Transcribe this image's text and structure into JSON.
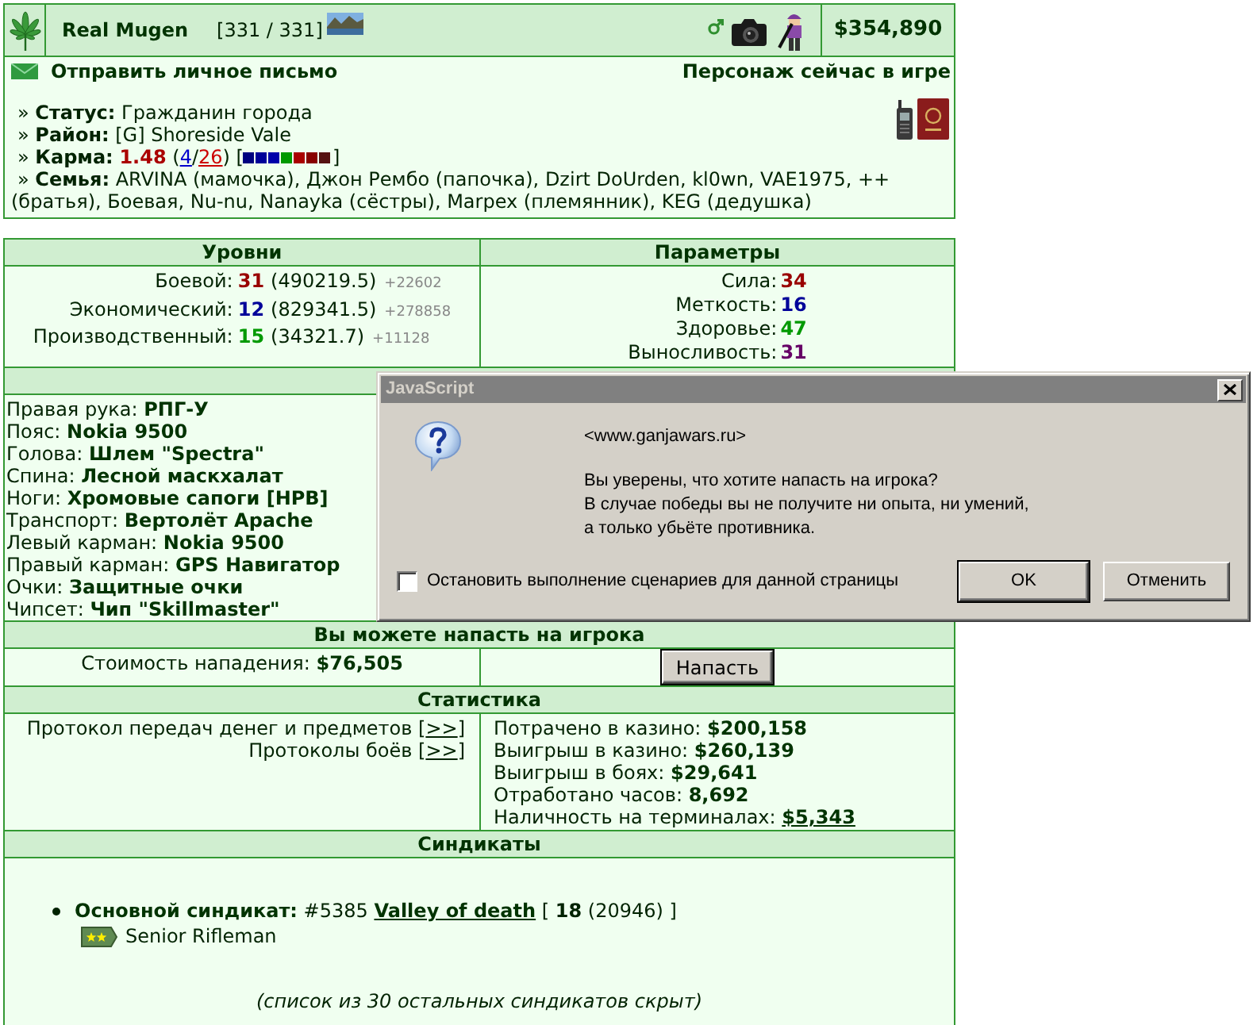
{
  "profile": {
    "name": "Real Mugen",
    "hp": "[331 / 331]",
    "money": "$354,890"
  },
  "contact": {
    "message_link": "Отправить личное письмо",
    "online_status": "Персонаж сейчас в игре"
  },
  "info": [
    {
      "kind": "text",
      "text": "» **Статус:** Гражданин города"
    },
    {
      "kind": "text",
      "text": "» **Район:** [G] Shoreside Vale"
    },
    {
      "kind": "karma",
      "label": "» **Карма:**",
      "value": "1.48",
      "votes": [
        {
          "kind": "plain",
          "text": "("
        },
        {
          "kind": "positive",
          "text": "4"
        },
        {
          "kind": "plain",
          "text": "/"
        },
        {
          "kind": "negative",
          "text": "26"
        },
        {
          "kind": "plain",
          "text": ")"
        }
      ],
      "bracket_open": "[",
      "squares": [
        {
          "color": "#000080"
        },
        {
          "color": "#000099"
        },
        {
          "color": "#0000aa"
        },
        {
          "color": "#009900"
        },
        {
          "color": "#aa0000"
        },
        {
          "color": "#880000"
        },
        {
          "color": "#551111"
        }
      ],
      "bracket_close": "]"
    },
    {
      "kind": "text",
      "text": "» **Семья:** ARVINA (мамочка), Джон Рембо (папочка), Dzirt DoUrden, kl0wn, VAE1975, ++ (братья), Боевая, Nu-nu, Nanayka (сёстры), Marpex (племянник), KEG (дедушка)"
    }
  ],
  "levels": {
    "title": "Уровни",
    "rows": [
      {
        "label": "Боевой:",
        "value": "31",
        "color": "#990000",
        "exp": "(490219.5)",
        "gain": "+22602"
      },
      {
        "label": "Экономический:",
        "value": "12",
        "color": "#000099",
        "exp": "(829341.5)",
        "gain": "+278858"
      },
      {
        "label": "Производственный:",
        "value": "15",
        "color": "#009900",
        "exp": "(34321.7)",
        "gain": "+11128"
      }
    ]
  },
  "parameters": {
    "title": "Параметры",
    "rows": [
      {
        "label": "Сила:",
        "value": "34",
        "color": "#990000"
      },
      {
        "label": "Меткость:",
        "value": "16",
        "color": "#000099"
      },
      {
        "label": "Здоровье:",
        "value": "47",
        "color": "#009900"
      },
      {
        "label": "Выносливость:",
        "value": "31",
        "color": "#660066"
      }
    ]
  },
  "equipment": [
    {
      "slot": "Правая рука:",
      "item": "РПГ-У"
    },
    {
      "slot": "Пояс:",
      "item": "Nokia 9500"
    },
    {
      "slot": "Голова:",
      "item": "Шлем \"Spectra\""
    },
    {
      "slot": "Спина:",
      "item": "Лесной маскхалат"
    },
    {
      "slot": "Ноги:",
      "item": "Хромовые сапоги [HPB]"
    },
    {
      "slot": "Транспорт:",
      "item": "Вертолёт Apache"
    },
    {
      "slot": "Левый карман:",
      "item": "Nokia 9500"
    },
    {
      "slot": "Правый карман:",
      "item": "GPS Навигатор"
    },
    {
      "slot": "Очки:",
      "item": "Защитные очки"
    },
    {
      "slot": "Чипсет:",
      "item": "Чип \"Skillmaster\""
    }
  ],
  "attack": {
    "title": "Вы можете напасть на игрока",
    "cost_label": "Стоимость нападения:",
    "cost": "$76,505",
    "button": "Напасть"
  },
  "statistics": {
    "title": "Статистика",
    "logs": [
      {
        "before": "Протокол передач денег и предметов [",
        "link": ">>",
        "after": "]"
      },
      {
        "before": "Протоколы боёв [",
        "link": ">>",
        "after": "]"
      }
    ],
    "rows": [
      {
        "kind": "plain",
        "label": "Потрачено в казино:",
        "value": "$200,158"
      },
      {
        "kind": "plain",
        "label": "Выигрыш в казино:",
        "value": "$260,139"
      },
      {
        "kind": "plain",
        "label": "Выигрыш в боях:",
        "value": "$29,641"
      },
      {
        "kind": "plain",
        "label": "Отработано часов:",
        "value": "8,692"
      },
      {
        "kind": "link",
        "label": "Наличность на терминалах:",
        "value": "$5,343"
      }
    ]
  },
  "syndicates": {
    "title": "Синдикаты",
    "main": {
      "label": "Основной синдикат:",
      "number": "#5385",
      "name": "Valley of death",
      "rank_text": "[ **18** (20946) ]",
      "role": "Senior Rifleman"
    },
    "hidden_note": "(список из 30 остальных синдикатов скрыт)"
  },
  "dialog": {
    "title": "JavaScript",
    "site": "<www.ganjawars.ru>",
    "message": [
      "Вы уверены, что хотите напасть на игрока?",
      "В случае победы вы не получите ни опыта, ни умений,",
      "а только убьёте противника."
    ],
    "stop_scripts": {
      "label": "Остановить выполнение сценариев для данной страницы",
      "checked": false
    },
    "buttons": [
      {
        "label": "OK",
        "default": true
      },
      {
        "label": "Отменить",
        "default": false
      }
    ]
  }
}
